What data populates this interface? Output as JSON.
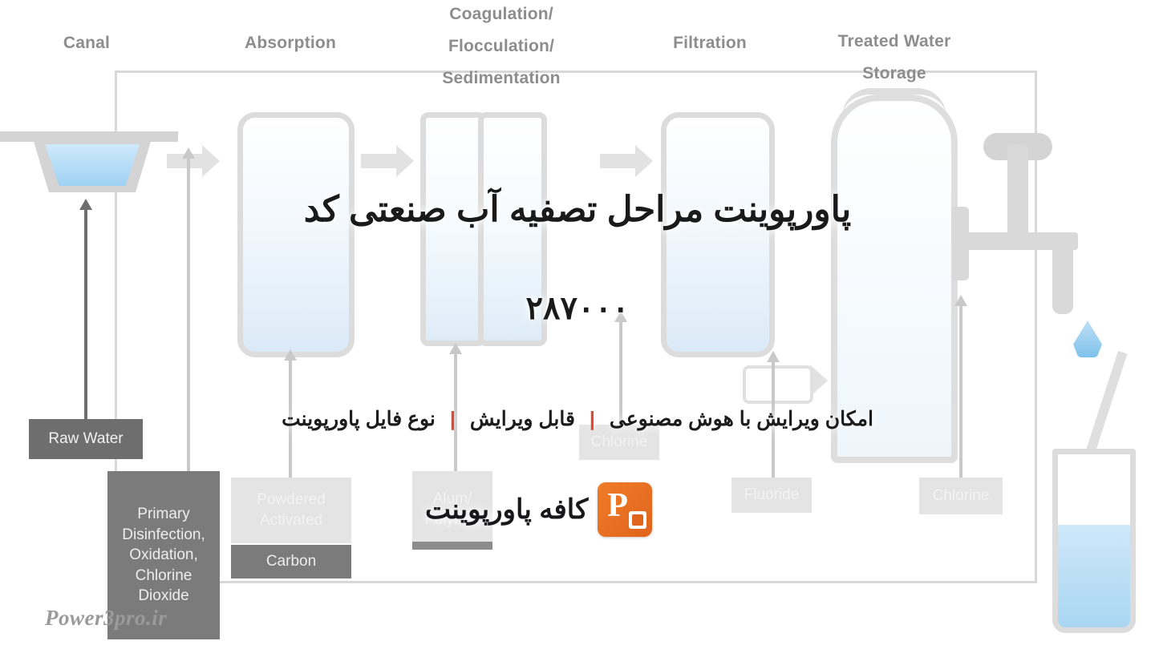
{
  "slide": {
    "title": "پاورپوینت مراحل تصفیه آب صنعتی کد",
    "code": "۲۸۷۰۰۰"
  },
  "meta": {
    "items": [
      {
        "label": "نوع فایل پاورپوینت"
      },
      {
        "label": "قابل ویرایش"
      },
      {
        "label": "امکان ویرایش با هوش مصنوعی"
      }
    ],
    "separator": "|",
    "separator_color": "#e0492f"
  },
  "brand": {
    "name": "کافه پاورپوینت",
    "logo_icon": "powerpoint-icon",
    "logo_letter": "P",
    "logo_color": "#e0641c"
  },
  "watermark": {
    "text": "Power3pro.ir"
  },
  "diagram": {
    "type": "water-treatment-process-flow",
    "stages": [
      {
        "name": "canal",
        "label": "Canal"
      },
      {
        "name": "absorption",
        "label": "Absorption"
      },
      {
        "name": "coagulation",
        "label": "Coagulation/\nFlocculation/\nSedimentation"
      },
      {
        "name": "filtration",
        "label": "Filtration"
      },
      {
        "name": "treated-water-storage",
        "label": "Treated Water\nStorage"
      }
    ],
    "stage_labels": {
      "canal": "Canal",
      "absorption": "Absorption",
      "coagulation_line1": "Coagulation/",
      "coagulation_line2": "Flocculation/",
      "coagulation_line3": "Sedimentation",
      "filtration": "Filtration",
      "storage_line1": "Treated Water",
      "storage_line2": "Storage"
    },
    "inputs": {
      "raw_water": "Raw Water",
      "primary_disinfection": "Primary\nDisinfection,\nOxidation,\nChlorine\nDioxide",
      "powdered_activated": "Powdered\nActivated",
      "carbon": "Carbon",
      "alum_polymer": "Alum/\nPolymer",
      "chlorine_mid": "Chlorine",
      "fluoride": "Fluoride",
      "chlorine_end": "Chlorine"
    },
    "colors": {
      "label_gray": "#8d8d8d",
      "box_light": "#e4e4e4",
      "box_dark": "#6e6e6e",
      "water_blue": "#9fd2f3",
      "outline": "#dcdcdc"
    }
  }
}
